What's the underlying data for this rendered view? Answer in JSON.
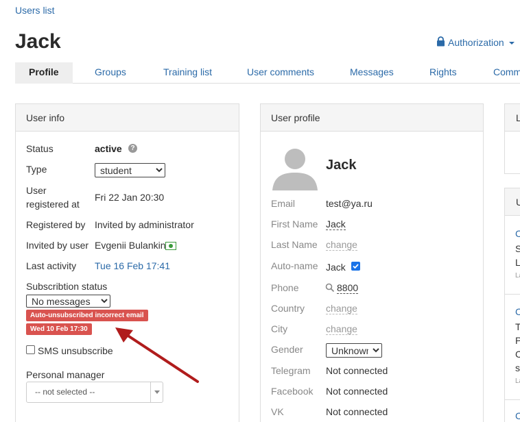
{
  "breadcrumb": {
    "label": "Users list"
  },
  "page": {
    "title": "Jack"
  },
  "auth": {
    "label": "Authorization"
  },
  "tabs": [
    {
      "label": "Profile"
    },
    {
      "label": "Groups"
    },
    {
      "label": "Training list"
    },
    {
      "label": "User comments"
    },
    {
      "label": "Messages"
    },
    {
      "label": "Rights"
    },
    {
      "label": "Comm"
    }
  ],
  "user_info": {
    "heading": "User info",
    "status_label": "Status",
    "status_value": "active",
    "type_label": "Type",
    "type_value": "student",
    "registered_label_1": "User",
    "registered_label_2": "registered at",
    "registered_value": "Fri 22 Jan 20:30",
    "registered_by_label": "Registered by",
    "registered_by_value": "Invited by administrator",
    "invited_by_label": "Invited by user",
    "invited_by_value": "Evgenii Bulankin",
    "last_activity_label": "Last activity",
    "last_activity_value": "Tue 16 Feb 17:41",
    "subscription_label": "Subscribtion status",
    "subscription_value": "No messages",
    "auto_unsub_badge": "Auto-unsubscribed incorrect email",
    "date_badge": "Wed 10 Feb 17:30",
    "sms_label": "SMS unsubscribe",
    "manager_label": "Personal manager",
    "manager_value": "-- not selected --"
  },
  "user_profile": {
    "heading": "User profile",
    "name": "Jack",
    "email_label": "Email",
    "email_value": "test@ya.ru",
    "first_name_label": "First Name",
    "first_name_value": "Jack",
    "last_name_label": "Last Name",
    "last_name_value": "change",
    "auto_name_label": "Auto-name",
    "auto_name_value": "Jack",
    "phone_label": "Phone",
    "phone_value": "8800",
    "country_label": "Country",
    "country_value": "change",
    "city_label": "City",
    "city_value": "change",
    "gender_label": "Gender",
    "gender_value": "Unknown",
    "telegram_label": "Telegram",
    "telegram_value": "Not connected",
    "facebook_label": "Facebook",
    "facebook_value": "Not connected",
    "vk_label": "VK",
    "vk_value": "Not connected"
  },
  "right_panel": {
    "head1": "L",
    "head2": "U",
    "c1": "C",
    "s1": "S",
    "l1": "L",
    "l1b": "La",
    "c2": "C",
    "t2": "T",
    "p2": "P",
    "c2b": "C",
    "s2": "s",
    "l2": "La",
    "c3": "C"
  },
  "colors": {
    "accent": "#2b6aa8",
    "badge": "#d9534f",
    "arrow": "#b01c1c",
    "checkbox": "#1a73e8"
  }
}
